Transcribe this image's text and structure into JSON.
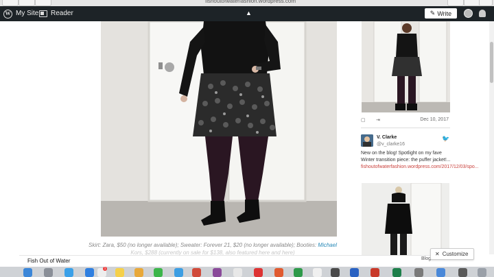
{
  "browser": {
    "url": "fishoutofwaterfashion.wordpress.com"
  },
  "wp_toolbar": {
    "my_site": "My Site",
    "reader": "Reader",
    "write": "Write"
  },
  "caption": {
    "line1_a": "Skirt: Zara, $50 (no longer available); Sweater: Forever 21, $20 (no longer available); Booties: ",
    "line1_link": "Michael",
    "line2": "Kors, $288 (currently on sale for $138, also featured here and here)"
  },
  "sidebar": {
    "post_date": "Dec 10, 2017",
    "tweet": {
      "name": "V. Clarke",
      "handle": "@v_clarke16",
      "text": "New on the blog! Spotlight on my fave Winter transition piece: the puffer jacket!...",
      "link": "fishoutofwaterfashion.wordpress.com/2017/12/03/spo..."
    }
  },
  "footer": {
    "site_title": "Fish Out of Water",
    "blog_label": "Blog a",
    "customize": "Customize"
  },
  "colors": {
    "toolbar_bg": "#1d2327",
    "link": "#2a8ab8",
    "tweet_link": "#c9403b"
  }
}
